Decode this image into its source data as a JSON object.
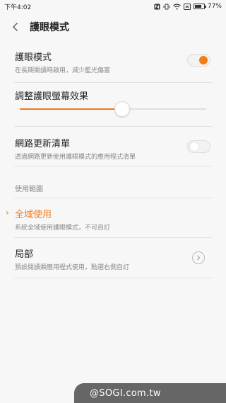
{
  "status_bar": {
    "time": "下午4:02",
    "battery": "77%",
    "battery_level": 0.77,
    "icons": [
      "nfc-icon",
      "vibrate-icon",
      "wifi-icon",
      "no-sim-icon",
      "battery-icon"
    ]
  },
  "header": {
    "title": "護眼模式"
  },
  "eye_mode": {
    "title": "護眼模式",
    "subtitle": "在長期閱讀時啟用，減少藍光傷害",
    "enabled": true
  },
  "adjust": {
    "title": "調整護眼螢幕效果",
    "value": 0.55
  },
  "network_update": {
    "title": "網路更新清單",
    "subtitle": "透過網路更新使用護眼模式的應用程式清單",
    "enabled": false
  },
  "scope": {
    "label": "使用範圍",
    "options": [
      {
        "title": "全域使用",
        "subtitle": "系統全域使用護眼模式，不可自訂",
        "selected": true
      },
      {
        "title": "局部",
        "subtitle": "預設閱讀類應用程式使用，點選右側自訂",
        "selected": false
      }
    ]
  },
  "watermark": "@SOGI.com.tw",
  "colors": {
    "accent": "#f07c1c",
    "background": "#f7f7f7",
    "divider": "#e3e3e3"
  }
}
